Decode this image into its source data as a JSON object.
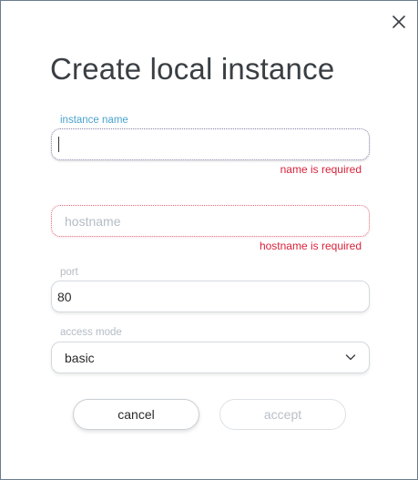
{
  "dialog": {
    "title": "Create local instance",
    "close_icon": "close-icon"
  },
  "fields": {
    "instance_name": {
      "label": "instance name",
      "value": "",
      "error": "name is required"
    },
    "hostname": {
      "placeholder": "hostname",
      "value": "",
      "error": "hostname is required"
    },
    "port": {
      "label": "port",
      "value": "80"
    },
    "access_mode": {
      "label": "access mode",
      "selected": "basic",
      "icon": "chevron-down-icon"
    }
  },
  "buttons": {
    "cancel": "cancel",
    "accept": "accept"
  },
  "colors": {
    "title": "#3a3f44",
    "active_label": "#4ba3cf",
    "inactive_label": "#b4bcc4",
    "error": "#d8223a",
    "disabled_text": "#b9c0c7",
    "border": "#6b7c8c"
  }
}
